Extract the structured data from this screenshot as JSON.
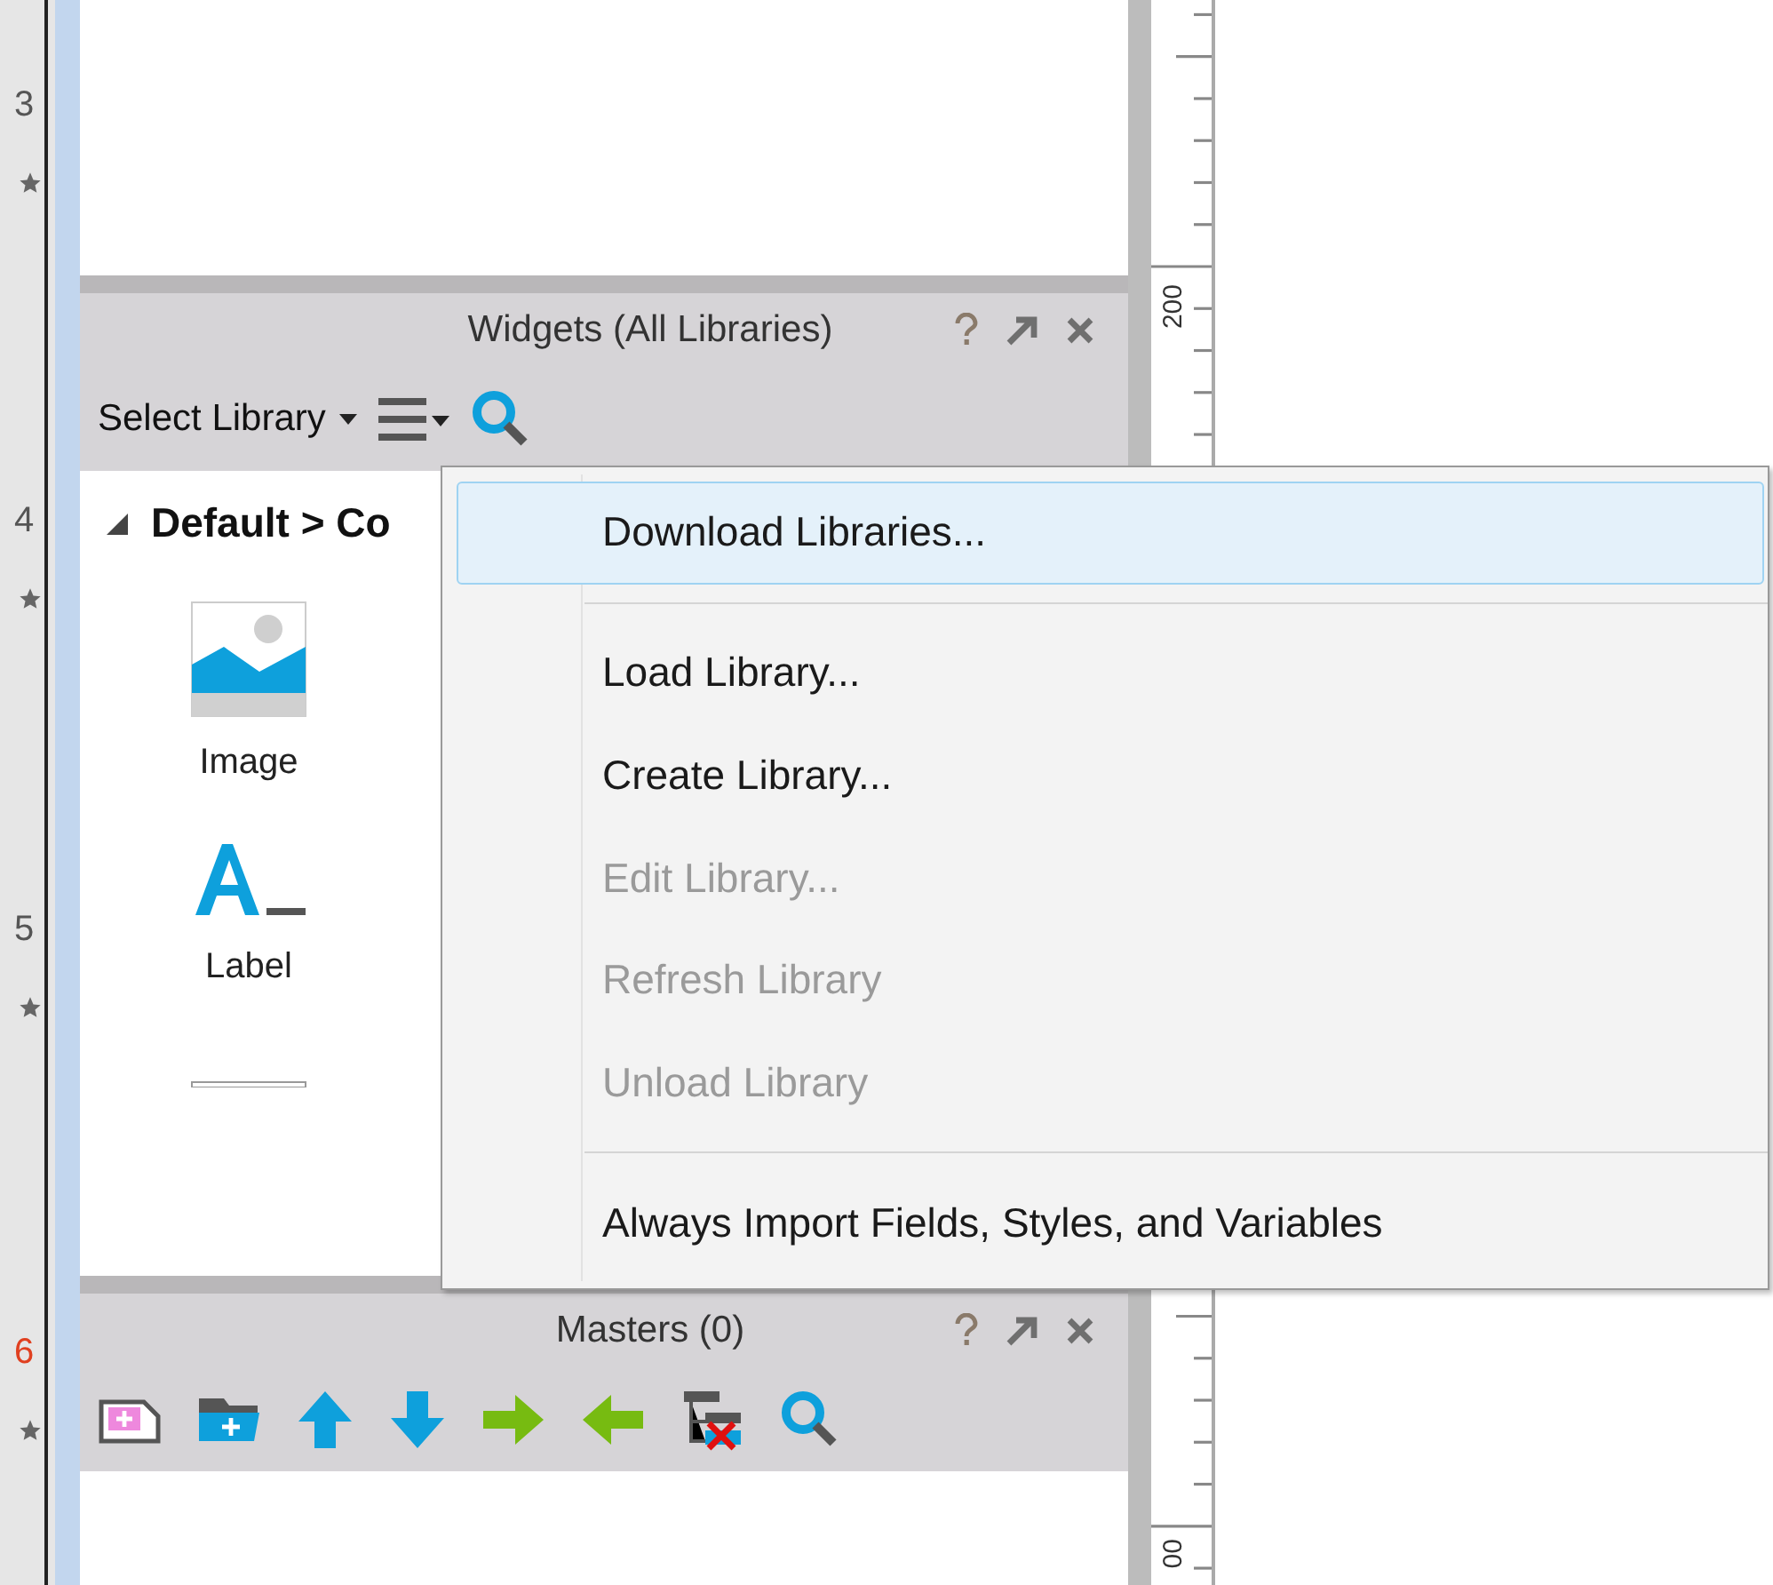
{
  "left_ruler": {
    "labels": [
      {
        "text": "3",
        "highlighted": false
      },
      {
        "text": "4",
        "highlighted": false
      },
      {
        "text": "5",
        "highlighted": false
      },
      {
        "text": "6",
        "highlighted": true
      }
    ]
  },
  "widgets_panel": {
    "title": "Widgets (All Libraries)",
    "library_select": "Select Library",
    "tree": {
      "label": "Default > Co",
      "expanded": true,
      "items": [
        {
          "kind": "image",
          "label": "Image"
        },
        {
          "kind": "label",
          "label": "Label"
        },
        {
          "kind": "box"
        }
      ]
    }
  },
  "masters_panel": {
    "title": "Masters (0)"
  },
  "canvas_ruler": {
    "labels": [
      "200",
      "00"
    ]
  },
  "menu": {
    "items": [
      {
        "kind": "item",
        "label": "Download Libraries...",
        "disabled": false,
        "selected": true
      },
      {
        "kind": "separator"
      },
      {
        "kind": "item",
        "label": "Load Library...",
        "disabled": false,
        "selected": false
      },
      {
        "kind": "item",
        "label": "Create Library...",
        "disabled": false,
        "selected": false
      },
      {
        "kind": "item",
        "label": "Edit Library...",
        "disabled": true,
        "selected": false
      },
      {
        "kind": "item",
        "label": "Refresh Library",
        "disabled": true,
        "selected": false
      },
      {
        "kind": "item",
        "label": "Unload Library",
        "disabled": true,
        "selected": false
      },
      {
        "kind": "separator"
      },
      {
        "kind": "item",
        "label": "Always Import Fields, Styles, and Variables",
        "disabled": false,
        "selected": false
      }
    ]
  }
}
